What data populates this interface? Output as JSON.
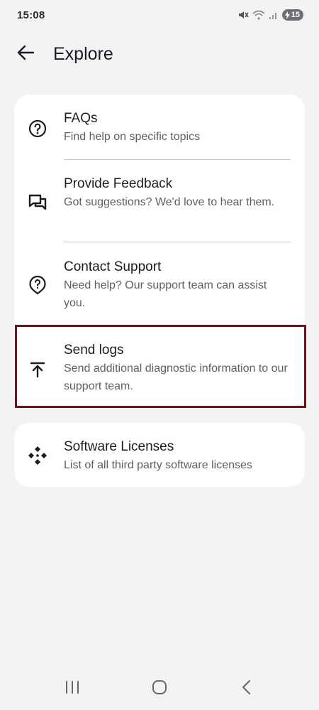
{
  "status_bar": {
    "time": "15:08",
    "battery_level": "15",
    "icons": [
      "mute-icon",
      "wifi-icon",
      "signal-icon",
      "battery-charging-icon"
    ]
  },
  "app_bar": {
    "title": "Explore",
    "back_icon": "arrow-back-icon"
  },
  "menu": {
    "items": [
      {
        "icon": "help-circle-icon",
        "title": "FAQs",
        "subtitle": "Find help on specific topics"
      },
      {
        "icon": "feedback-chat-icon",
        "title": "Provide Feedback",
        "subtitle": "Got suggestions? We'd love to hear them."
      },
      {
        "icon": "support-bubble-icon",
        "title": "Contact Support",
        "subtitle": "Need help? Our support team can assist you."
      },
      {
        "icon": "upload-icon",
        "title": "Send logs",
        "subtitle": "Send additional diagnostic information to our support team."
      }
    ],
    "highlight_color": "#7b0d10"
  },
  "licenses": {
    "icon": "licenses-diamond-icon",
    "title": "Software Licenses",
    "subtitle": "List of all third party software licenses"
  },
  "nav_bar": {
    "icons": [
      "recent-apps-icon",
      "home-icon",
      "back-nav-icon"
    ]
  }
}
